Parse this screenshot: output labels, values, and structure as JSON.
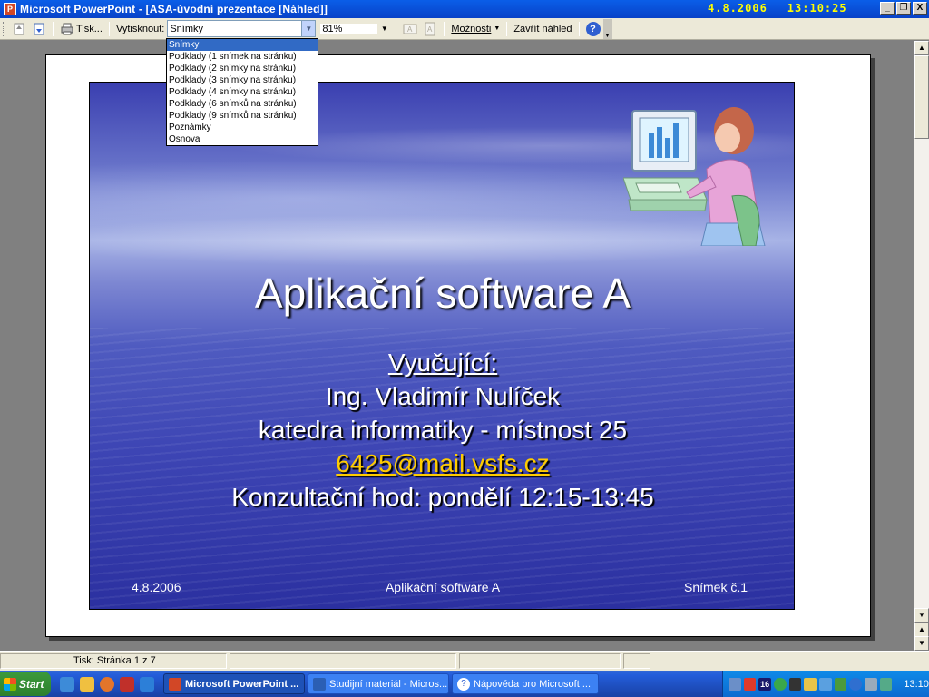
{
  "window": {
    "title": "Microsoft PowerPoint - [ASA-úvodní prezentace [Náhled]]",
    "date": "4.8.2006",
    "time": "13:10:25",
    "minimize": "_",
    "restore": "❐",
    "close": "X"
  },
  "toolbar": {
    "print_label": "Tisk...",
    "print_what_label": "Vytisknout:",
    "print_what_value": "Snímky",
    "zoom_value": "81%",
    "options_label": "Možnosti",
    "close_preview_label": "Zavřít náhled",
    "help": "?"
  },
  "print_what_options": [
    "Snímky",
    "Podklady (1 snímek na stránku)",
    "Podklady (2 snímky na stránku)",
    "Podklady (3 snímky na stránku)",
    "Podklady (4 snímky na stránku)",
    "Podklady (6 snímků na stránku)",
    "Podklady (9 snímků na stránku)",
    "Poznámky",
    "Osnova"
  ],
  "slide": {
    "title": "Aplikační software A",
    "lines": {
      "teacher_label": "Vyučující:",
      "teacher_name": "Ing. Vladimír Nulíček",
      "department": "katedra informatiky - místnost 25",
      "email": "6425@mail.vsfs.cz",
      "consultation": "Konzultační hod: pondělí 12:15-13:45"
    },
    "footer_date": "4.8.2006",
    "footer_title": "Aplikační software A",
    "footer_slide": "Snímek č.1"
  },
  "status": {
    "page": "Tisk: Stránka 1 z 7"
  },
  "taskbar": {
    "start_label": "Start",
    "tasks": [
      "Microsoft PowerPoint ...",
      "Studijní materiál - Micros...",
      "Nápověda pro Microsoft ..."
    ],
    "tray_badge": "16",
    "clock": "13:10"
  },
  "colors": {
    "titlebar": "#0a5ee8",
    "clock": "#ffff00",
    "slide_link": "#ffcc00"
  }
}
